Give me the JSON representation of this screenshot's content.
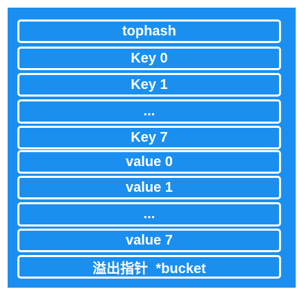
{
  "bucket": {
    "fields": [
      {
        "label": "tophash"
      },
      {
        "label": "Key 0"
      },
      {
        "label": "Key 1"
      },
      {
        "label": "..."
      },
      {
        "label": "Key 7"
      },
      {
        "label": "value 0"
      },
      {
        "label": "value 1"
      },
      {
        "label": "..."
      },
      {
        "label": "value 7"
      },
      {
        "label": "溢出指针  *bucket"
      }
    ]
  },
  "colors": {
    "fill": "#1a8ff0",
    "border": "#ffffff",
    "text": "#ffffff"
  }
}
